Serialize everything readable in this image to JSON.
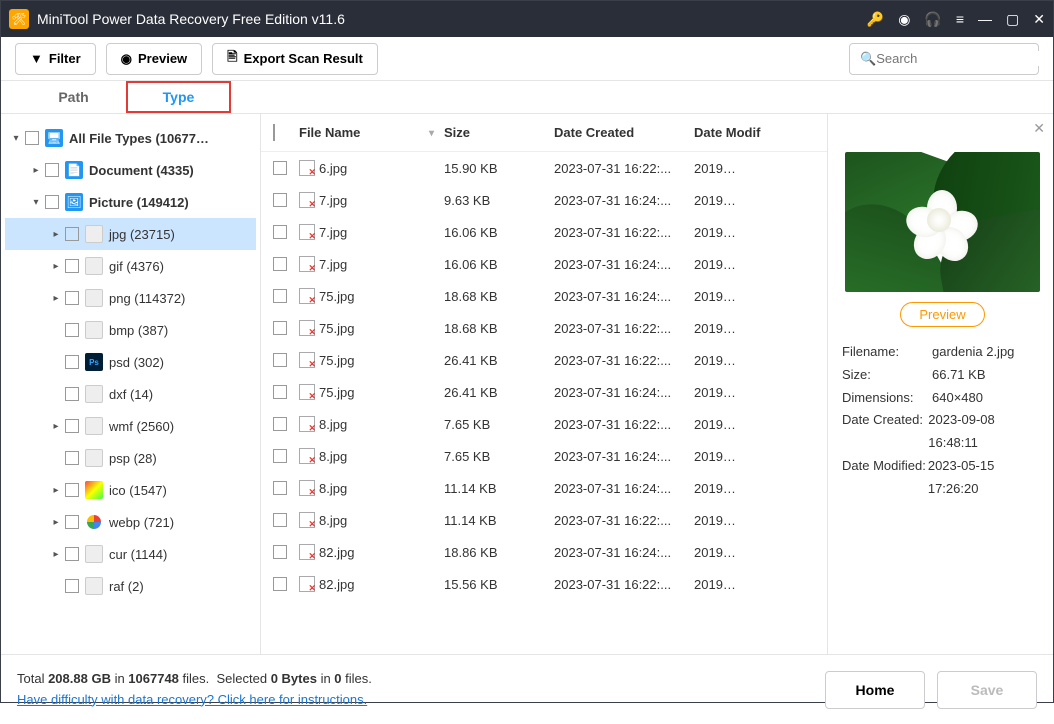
{
  "window": {
    "title": "MiniTool Power Data Recovery Free Edition v11.6"
  },
  "toolbar": {
    "filter": "Filter",
    "preview": "Preview",
    "export": "Export Scan Result",
    "search_placeholder": "Search"
  },
  "tabs": {
    "path": "Path",
    "type": "Type"
  },
  "tree": {
    "all": "All File Types (10677…",
    "document": "Document (4335)",
    "picture": "Picture (149412)",
    "jpg": "jpg (23715)",
    "gif": "gif (4376)",
    "png": "png (114372)",
    "bmp": "bmp (387)",
    "psd": "psd (302)",
    "dxf": "dxf (14)",
    "wmf": "wmf (2560)",
    "psp": "psp (28)",
    "ico": "ico (1547)",
    "webp": "webp (721)",
    "cur": "cur (1144)",
    "raf": "raf (2)"
  },
  "columns": {
    "name": "File Name",
    "size": "Size",
    "created": "Date Created",
    "modified": "Date Modif"
  },
  "files": [
    {
      "name": "6.jpg",
      "size": "15.90 KB",
      "created": "2023-07-31 16:22:...",
      "modified": "2019…"
    },
    {
      "name": "7.jpg",
      "size": "9.63 KB",
      "created": "2023-07-31 16:24:...",
      "modified": "2019…"
    },
    {
      "name": "7.jpg",
      "size": "16.06 KB",
      "created": "2023-07-31 16:22:...",
      "modified": "2019…"
    },
    {
      "name": "7.jpg",
      "size": "16.06 KB",
      "created": "2023-07-31 16:24:...",
      "modified": "2019…"
    },
    {
      "name": "75.jpg",
      "size": "18.68 KB",
      "created": "2023-07-31 16:24:...",
      "modified": "2019…"
    },
    {
      "name": "75.jpg",
      "size": "18.68 KB",
      "created": "2023-07-31 16:22:...",
      "modified": "2019…"
    },
    {
      "name": "75.jpg",
      "size": "26.41 KB",
      "created": "2023-07-31 16:22:...",
      "modified": "2019…"
    },
    {
      "name": "75.jpg",
      "size": "26.41 KB",
      "created": "2023-07-31 16:24:...",
      "modified": "2019…"
    },
    {
      "name": "8.jpg",
      "size": "7.65 KB",
      "created": "2023-07-31 16:22:...",
      "modified": "2019…"
    },
    {
      "name": "8.jpg",
      "size": "7.65 KB",
      "created": "2023-07-31 16:24:...",
      "modified": "2019…"
    },
    {
      "name": "8.jpg",
      "size": "11.14 KB",
      "created": "2023-07-31 16:24:...",
      "modified": "2019…"
    },
    {
      "name": "8.jpg",
      "size": "11.14 KB",
      "created": "2023-07-31 16:22:...",
      "modified": "2019…"
    },
    {
      "name": "82.jpg",
      "size": "18.86 KB",
      "created": "2023-07-31 16:24:...",
      "modified": "2019…"
    },
    {
      "name": "82.jpg",
      "size": "15.56 KB",
      "created": "2023-07-31 16:22:...",
      "modified": "2019…"
    }
  ],
  "preview": {
    "button": "Preview",
    "labels": {
      "filename": "Filename:",
      "size": "Size:",
      "dimensions": "Dimensions:",
      "created": "Date Created:",
      "modified": "Date Modified:"
    },
    "values": {
      "filename": "gardenia 2.jpg",
      "size": "66.71 KB",
      "dimensions": "640×480",
      "created": "2023-09-08 16:48:11",
      "modified": "2023-05-15 17:26:20"
    }
  },
  "footer": {
    "total_prefix": "Total ",
    "total_size": "208.88 GB",
    "total_mid": " in ",
    "total_files": "1067748",
    "total_suffix": " files.",
    "selected_prefix": "Selected ",
    "selected_bytes": "0 Bytes",
    "selected_mid": " in ",
    "selected_count": "0",
    "selected_suffix": " files.",
    "help_link": "Have difficulty with data recovery? Click here for instructions.",
    "home": "Home",
    "save": "Save"
  }
}
